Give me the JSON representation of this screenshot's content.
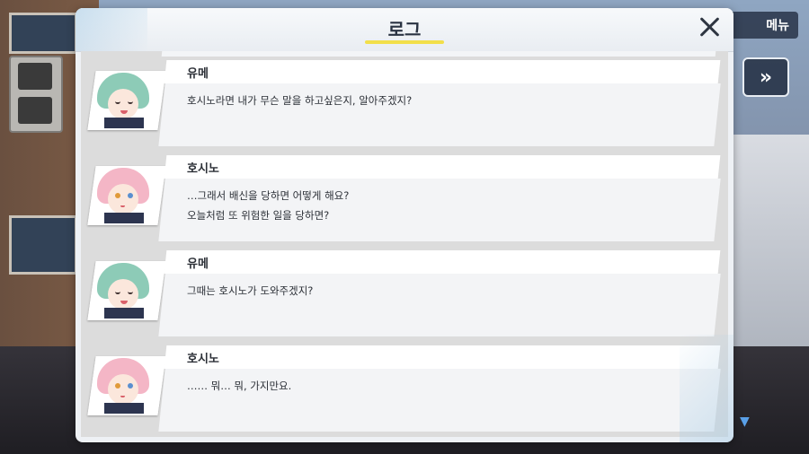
{
  "menu_label": "메뉴",
  "skip_label": "»",
  "log": {
    "title": "로그",
    "entries": [
      {
        "speaker": "유메",
        "character": "yume",
        "lines": [
          "호시노라면 내가 무슨 말을 하고싶은지, 알아주겠지?"
        ]
      },
      {
        "speaker": "호시노",
        "character": "hoshino",
        "lines": [
          "…그래서 배신을 당하면 어떻게 해요?",
          "오늘처럼 또 위험한 일을 당하면?"
        ]
      },
      {
        "speaker": "유메",
        "character": "yume",
        "lines": [
          "그때는 호시노가 도와주겠지?"
        ]
      },
      {
        "speaker": "호시노",
        "character": "hoshino",
        "lines": [
          "…… 뭐… 뭐, 가지만요."
        ]
      }
    ]
  },
  "colors": {
    "title_underline": "#f2df4a",
    "scroll_arrow": "#5aa0e8"
  },
  "icons": {
    "close": "close-icon",
    "skip": "fast-forward-icon",
    "scroll_down": "triangle-down-icon"
  }
}
